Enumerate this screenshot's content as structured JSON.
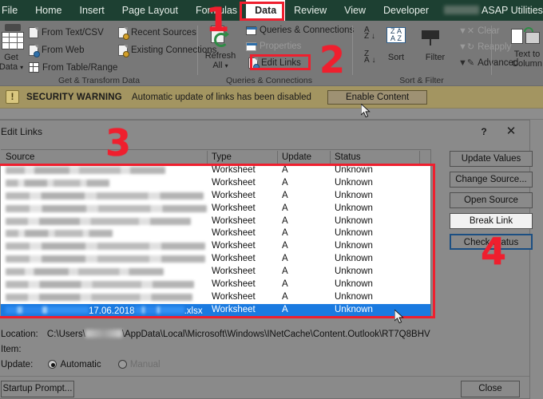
{
  "ribbon": {
    "tabs": [
      {
        "label": "File",
        "active": false
      },
      {
        "label": "Home",
        "active": false
      },
      {
        "label": "Insert",
        "active": false
      },
      {
        "label": "Page Layout",
        "active": false
      },
      {
        "label": "Formulas",
        "active": false
      },
      {
        "label": "Data",
        "active": true
      },
      {
        "label": "Review",
        "active": false
      },
      {
        "label": "View",
        "active": false
      },
      {
        "label": "Developer",
        "active": false
      },
      {
        "label": "",
        "active": false,
        "redacted": true
      },
      {
        "label": "ASAP Utilities",
        "active": false
      }
    ],
    "groups": [
      {
        "name": "Get & Transform Data",
        "label": "Get & Transform Data"
      },
      {
        "name": "Queries & Connections",
        "label": "Queries & Connections"
      },
      {
        "name": "Sort & Filter",
        "label": "Sort & Filter"
      }
    ],
    "get_data_label_line1": "Get",
    "get_data_label_line2": "Data",
    "commands": {
      "from_text_csv": "From Text/CSV",
      "from_web": "From Web",
      "from_table_range": "From Table/Range",
      "recent_sources": "Recent Sources",
      "existing_connections": "Existing Connections",
      "refresh_all_line1": "Refresh",
      "refresh_all_line2": "All",
      "queries_connections": "Queries & Connections",
      "properties": "Properties",
      "edit_links": "Edit Links",
      "sort_label": "Sort",
      "filter_label": "Filter",
      "clear": "Clear",
      "reapply": "Reapply",
      "advanced": "Advanced",
      "text_to_columns_line1": "Text to",
      "text_to_columns_line2": "Column"
    }
  },
  "security_bar": {
    "title": "SECURITY WARNING",
    "message": "Automatic update of links has been disabled",
    "button": "Enable Content",
    "icon": "warning-icon",
    "bg": "#a39561"
  },
  "dialog": {
    "title": "Edit Links",
    "help_glyph": "?",
    "close_glyph": "✕",
    "columns": [
      "Source",
      "Type",
      "Update",
      "Status"
    ],
    "rows": [
      {
        "source": "",
        "source_redacted": true,
        "redacted_width": 200,
        "type": "Worksheet",
        "update": "A",
        "status": "Unknown",
        "selected": false
      },
      {
        "source": "",
        "source_redacted": true,
        "redacted_width": 130,
        "type": "Worksheet",
        "update": "A",
        "status": "Unknown",
        "selected": false
      },
      {
        "source": "",
        "source_redacted": true,
        "redacted_width": 248,
        "type": "Worksheet",
        "update": "A",
        "status": "Unknown",
        "selected": false
      },
      {
        "source": "",
        "source_redacted": true,
        "redacted_width": 252,
        "type": "Worksheet",
        "update": "A",
        "status": "Unknown",
        "selected": false
      },
      {
        "source": "",
        "source_redacted": true,
        "redacted_width": 232,
        "type": "Worksheet",
        "update": "A",
        "status": "Unknown",
        "selected": false
      },
      {
        "source": "",
        "source_redacted": true,
        "redacted_width": 134,
        "type": "Worksheet",
        "update": "A",
        "status": "Unknown",
        "selected": false
      },
      {
        "source": "",
        "source_redacted": true,
        "redacted_width": 250,
        "type": "Worksheet",
        "update": "A",
        "status": "Unknown",
        "selected": false
      },
      {
        "source": "",
        "source_redacted": true,
        "redacted_width": 250,
        "type": "Worksheet",
        "update": "A",
        "status": "Unknown",
        "selected": false
      },
      {
        "source": "",
        "source_redacted": true,
        "redacted_width": 198,
        "type": "Worksheet",
        "update": "A",
        "status": "Unknown",
        "selected": false
      },
      {
        "source": "",
        "source_redacted": true,
        "redacted_width": 236,
        "type": "Worksheet",
        "update": "A",
        "status": "Unknown",
        "selected": false
      },
      {
        "source": "",
        "source_redacted": true,
        "redacted_width": 234,
        "type": "Worksheet",
        "update": "A",
        "status": "Unknown",
        "selected": false
      },
      {
        "source_date": "17.06.2018",
        "source_ext": ".xlsx",
        "source_redacted": true,
        "type": "Worksheet",
        "update": "A",
        "status": "Unknown",
        "selected": true
      }
    ],
    "buttons": {
      "update_values": "Update Values",
      "change_source": "Change Source...",
      "open_source": "Open Source",
      "break_link": "Break Link",
      "check_status": "Check Status",
      "startup_prompt": "Startup Prompt...",
      "close": "Close"
    },
    "info": {
      "location_label": "Location:",
      "location_prefix": "C:\\Users\\",
      "location_suffix": "\\AppData\\Local\\Microsoft\\Windows\\INetCache\\Content.Outlook\\RT7Q8BHV",
      "item_label": "Item:",
      "item_value": "",
      "update_label": "Update:",
      "option_automatic": "Automatic",
      "option_manual": "Manual",
      "selected_option": "Automatic"
    }
  },
  "annotations": {
    "accent_color": "#ef1f2e",
    "steps": [
      {
        "number": "1",
        "target": "data-tab"
      },
      {
        "number": "2",
        "target": "edit-links-button"
      },
      {
        "number": "3",
        "target": "links-table"
      },
      {
        "number": "4",
        "target": "break-link-button"
      }
    ]
  }
}
